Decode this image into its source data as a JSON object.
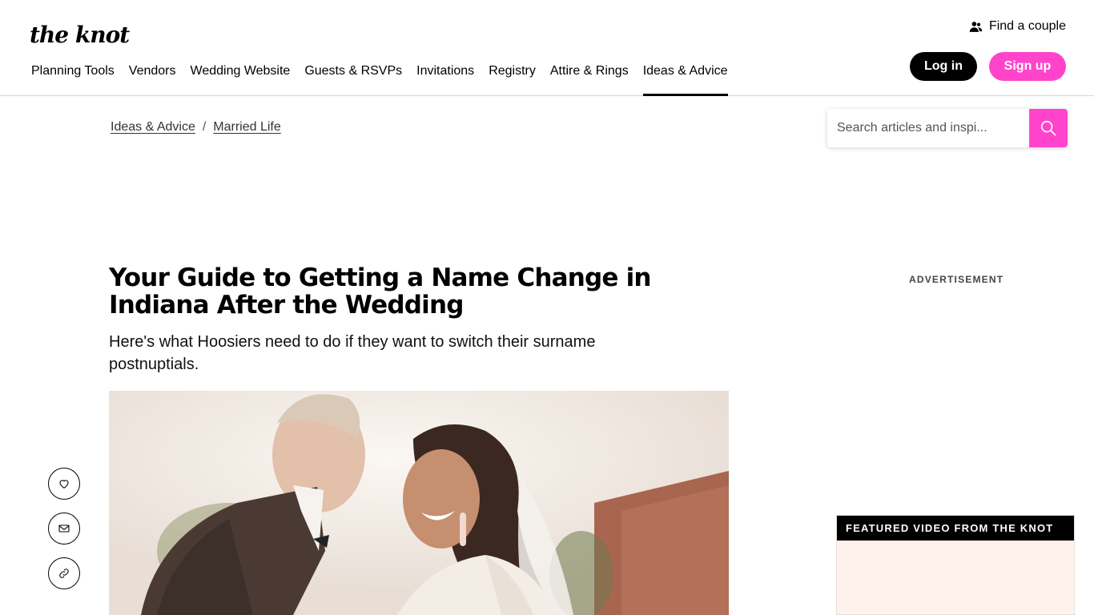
{
  "logo": "the knot",
  "nav": {
    "items": [
      {
        "label": "Planning Tools"
      },
      {
        "label": "Vendors"
      },
      {
        "label": "Wedding Website"
      },
      {
        "label": "Guests & RSVPs"
      },
      {
        "label": "Invitations"
      },
      {
        "label": "Registry"
      },
      {
        "label": "Attire & Rings"
      },
      {
        "label": "Ideas & Advice",
        "active": true
      }
    ]
  },
  "header": {
    "find_couple": "Find a couple",
    "login": "Log in",
    "signup": "Sign up"
  },
  "breadcrumb": {
    "items": [
      "Ideas & Advice",
      "Married Life"
    ],
    "separator": "/"
  },
  "search": {
    "placeholder": "Search articles and inspi..."
  },
  "article": {
    "title": "Your Guide to Getting a Name Change in Indiana After the Wedding",
    "subtitle": "Here's what Hoosiers need to do if they want to switch their surname postnuptials."
  },
  "share": {
    "icons": [
      "heart-icon",
      "mail-icon",
      "link-icon"
    ]
  },
  "sidebar": {
    "advertisement": "ADVERTISEMENT",
    "featured_video": "FEATURED VIDEO FROM THE KNOT"
  },
  "colors": {
    "brand_pink": "#ff44cb",
    "black": "#000000",
    "video_bg": "#fdf3ec"
  }
}
